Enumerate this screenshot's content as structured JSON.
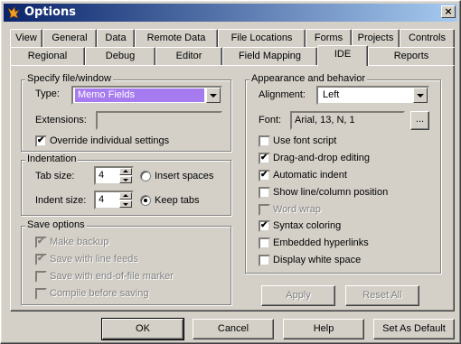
{
  "window": {
    "title": "Options",
    "close_glyph": "×"
  },
  "tabs_back": [
    "View",
    "General",
    "Data",
    "Remote Data",
    "File Locations",
    "Forms",
    "Projects",
    "Controls"
  ],
  "tabs_front": [
    "Regional",
    "Debug",
    "Editor",
    "Field Mapping",
    "IDE",
    "Reports"
  ],
  "active_tab": "IDE",
  "specify": {
    "legend": "Specify file/window",
    "type_label": "Type:",
    "type_value": "Memo Fields",
    "extensions_label": "Extensions:",
    "extensions_value": "",
    "override_label": "Override individual settings",
    "override_checked": true
  },
  "indentation": {
    "legend": "Indentation",
    "tab_size_label": "Tab size:",
    "tab_size_value": "4",
    "indent_size_label": "Indent size:",
    "indent_size_value": "4",
    "insert_spaces_label": "Insert spaces",
    "keep_tabs_label": "Keep tabs",
    "selected": "Keep tabs"
  },
  "save": {
    "legend": "Save options",
    "items": [
      {
        "label": "Make backup",
        "checked": true,
        "enabled": false
      },
      {
        "label": "Save with line feeds",
        "checked": true,
        "enabled": false
      },
      {
        "label": "Save with end-of-file marker",
        "checked": false,
        "enabled": false
      },
      {
        "label": "Compile before saving",
        "checked": false,
        "enabled": false
      }
    ]
  },
  "appearance": {
    "legend": "Appearance and behavior",
    "alignment_label": "Alignment:",
    "alignment_value": "Left",
    "font_label": "Font:",
    "font_value": "Arial, 13, N, 1",
    "font_button": "...",
    "options": [
      {
        "label": "Use font script",
        "checked": false,
        "enabled": true
      },
      {
        "label": "Drag-and-drop editing",
        "checked": true,
        "enabled": true
      },
      {
        "label": "Automatic indent",
        "checked": true,
        "enabled": true
      },
      {
        "label": "Show line/column position",
        "checked": false,
        "enabled": true
      },
      {
        "label": "Word wrap",
        "checked": false,
        "enabled": false
      },
      {
        "label": "Syntax coloring",
        "checked": true,
        "enabled": true
      },
      {
        "label": "Embedded hyperlinks",
        "checked": false,
        "enabled": true
      },
      {
        "label": "Display white space",
        "checked": false,
        "enabled": true
      }
    ],
    "apply_label": "Apply",
    "reset_all_label": "Reset All"
  },
  "footer": {
    "ok": "OK",
    "cancel": "Cancel",
    "help": "Help",
    "set_default": "Set As Default"
  },
  "colors": {
    "titlebar_start": "#0a246a",
    "titlebar_end": "#a6caf0",
    "selection": "#a77bf0",
    "face": "#d4d0c8"
  },
  "icons": {
    "title": "fox-app-icon",
    "check": "✔"
  }
}
